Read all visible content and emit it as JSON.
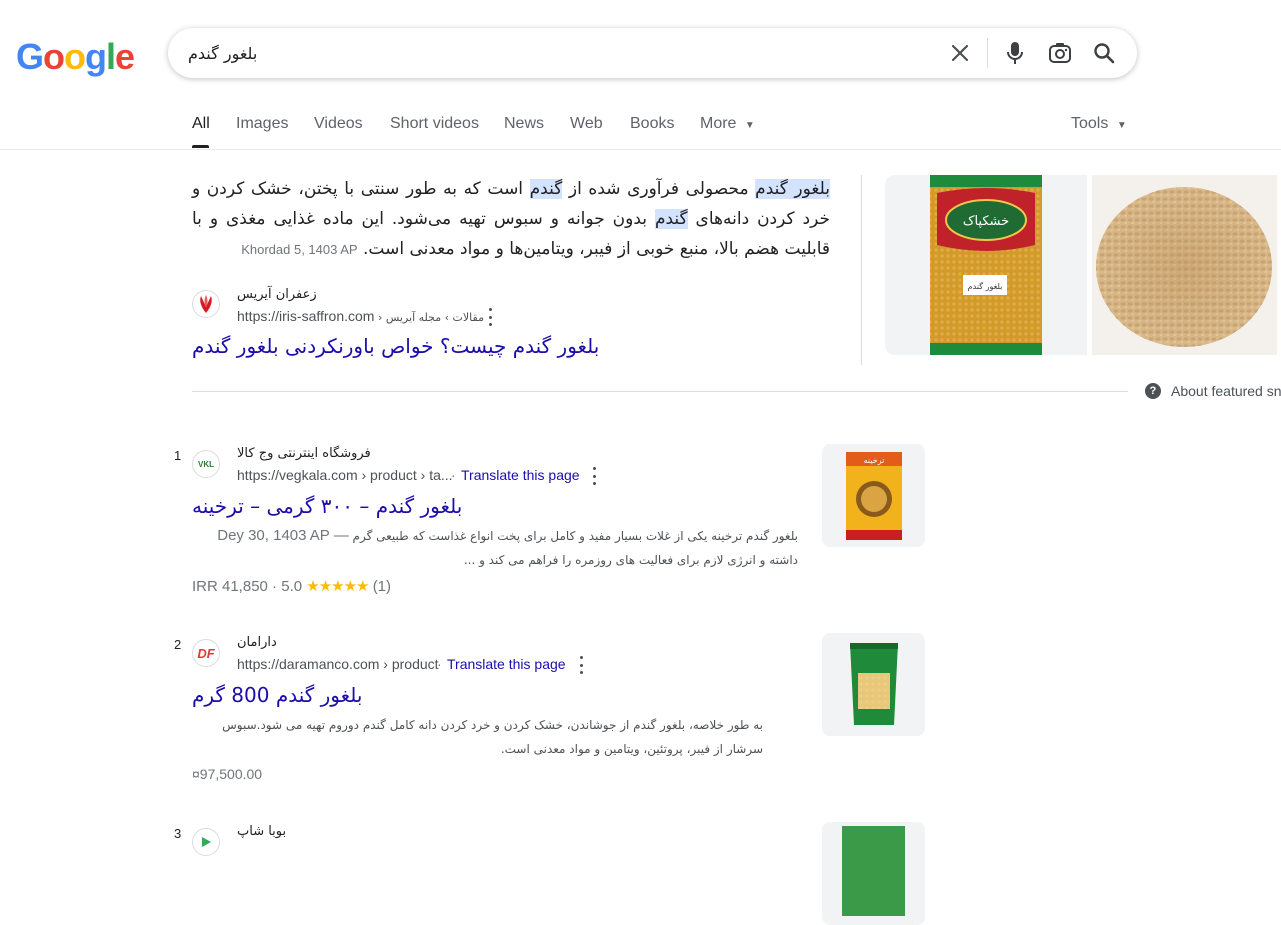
{
  "logo": {
    "text": "Google"
  },
  "search": {
    "query": "بلغور گندم"
  },
  "icons": {
    "clear": "close-icon",
    "mic": "microphone-icon",
    "lens": "camera-lens-icon",
    "search": "search-icon"
  },
  "tabs": [
    {
      "label": "All",
      "active": true
    },
    {
      "label": "Images"
    },
    {
      "label": "Videos"
    },
    {
      "label": "Short videos"
    },
    {
      "label": "News"
    },
    {
      "label": "Web"
    },
    {
      "label": "Books"
    },
    {
      "label": "More"
    }
  ],
  "tools_label": "Tools",
  "featured_snippet": {
    "parts": [
      "بلغور گندم",
      " محصولی فرآوری شده از ",
      "گندم",
      " است که به طور سنتی با پختن، خشک کردن و خرد کردن دانه‌های ",
      "گندم",
      " بدون جوانه و سبوس تهیه می‌شود. این ماده غذایی مغذی و با قابلیت هضم بالا، منبع خوبی از فیبر، ویتامین‌ها و مواد معدنی است."
    ],
    "date": "Khordad 5, 1403 AP",
    "source_name": "زعفران آیریس",
    "source_url": "https://iris-saffron.com",
    "source_crumbs": " › مقالات › مجله آیریس",
    "link_title": "بلغور گندم چیست؟ خواص باورنکردنی بلغور گندم",
    "about_label": "About featured sni",
    "image_brand": "خشکپاک",
    "image_label": "بلغور گندم"
  },
  "results": [
    {
      "rank": "1",
      "site_name": "فروشگاه اینترنتی وج کالا",
      "url": "https://vegkala.com › product › ta...",
      "translate": "Translate this page",
      "title": "بلغور گندم – ۳۰۰ گرمی – ترخینه",
      "date": "Dey 30, 1403 AP —",
      "snippet_line1": "بلغور گندم ترخینه یکی از غلات بسیار مفید و کامل برای پخت انواع غذاست که طبیعی گرم",
      "snippet_line2": "داشته و انرژی لازم برای فعالیت های روزمره را فراهم می کند و ...",
      "price": "IRR 41,850",
      "rating": "5.0",
      "stars": "★★★★★",
      "reviews": "(1)",
      "favicon_text": "VKL",
      "thumb_brand": "ترخینه"
    },
    {
      "rank": "2",
      "site_name": "دارامان",
      "url": "https://daramanco.com › product",
      "translate": "Translate this page",
      "title": "بلغور گندم 800 گرم",
      "snippet_line1": "به طور خلاصه، بلغور گندم از جوشاندن، خشک کردن و خرد کردن دانه کامل گندم دوروم تهیه می شود.سبوس",
      "snippet_line2": "سرشار از فیبر، پروتئین، ویتامین و مواد معدنی است.",
      "price": "¤97,500.00",
      "favicon_text": "DF"
    },
    {
      "rank": "3",
      "site_name": "بوبا شاپ"
    }
  ],
  "colors": {
    "link": "#1a0dab",
    "highlight": "#d3e3fd",
    "star": "#fbbc04"
  }
}
